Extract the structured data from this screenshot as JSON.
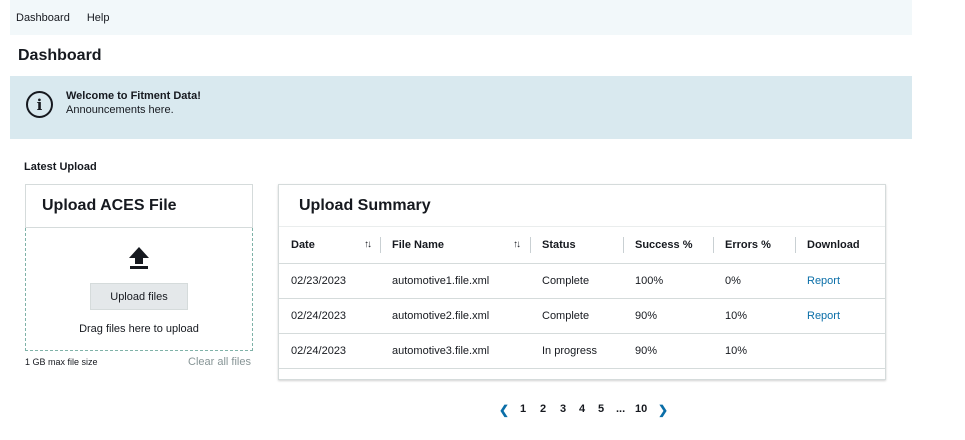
{
  "topnav": {
    "items": [
      "Dashboard",
      "Help"
    ]
  },
  "page": {
    "title": "Dashboard"
  },
  "banner": {
    "title": "Welcome to Fitment Data!",
    "body": "Announcements here.",
    "icon": "info-icon"
  },
  "latest_upload": {
    "label": "Latest Upload"
  },
  "upload_card": {
    "title": "Upload ACES File",
    "button_label": "Upload files",
    "drop_text": "Drag files here to upload",
    "max_size": "1 GB max file size",
    "clear_label": "Clear all files"
  },
  "summary": {
    "title": "Upload Summary",
    "columns": [
      "Date",
      "File Name",
      "Status",
      "Success %",
      "Errors %",
      "Download"
    ],
    "rows": [
      {
        "date": "02/23/2023",
        "file": "automotive1.file.xml",
        "status": "Complete",
        "success": "100%",
        "errors": "0%",
        "download": "Report"
      },
      {
        "date": "02/24/2023",
        "file": "automotive2.file.xml",
        "status": "Complete",
        "success": "90%",
        "errors": "10%",
        "download": "Report"
      },
      {
        "date": "02/24/2023",
        "file": "automotive3.file.xml",
        "status": "In progress",
        "success": "90%",
        "errors": "10%",
        "download": ""
      }
    ]
  },
  "pagination": {
    "pages": [
      "1",
      "2",
      "3",
      "4",
      "5",
      "...",
      "10"
    ]
  },
  "colors": {
    "nav_bg": "#f2f8fa",
    "banner_bg": "#d9e9ef",
    "link": "#0a6ea8"
  }
}
